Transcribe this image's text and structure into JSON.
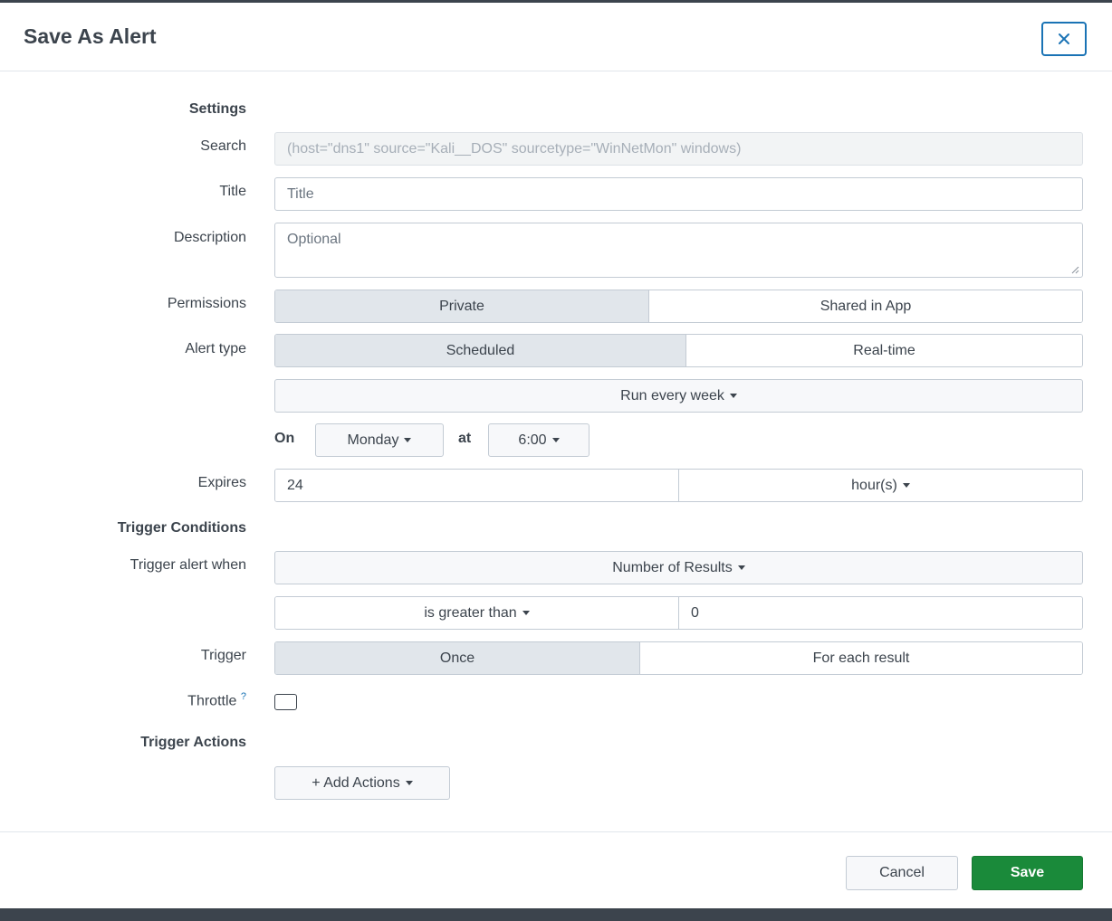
{
  "dialog": {
    "title": "Save As Alert"
  },
  "settings": {
    "heading": "Settings",
    "search": {
      "label": "Search",
      "value": "(host=\"dns1\" source=\"Kali__DOS\" sourcetype=\"WinNetMon\" windows)"
    },
    "title": {
      "label": "Title",
      "placeholder": "Title"
    },
    "description": {
      "label": "Description",
      "placeholder": "Optional"
    },
    "permissions": {
      "label": "Permissions",
      "options": [
        "Private",
        "Shared in App"
      ],
      "selected": "Private"
    },
    "alert_type": {
      "label": "Alert type",
      "options": [
        "Scheduled",
        "Real-time"
      ],
      "selected": "Scheduled"
    },
    "schedule": {
      "value": "Run every week"
    },
    "on": {
      "label": "On",
      "day": "Monday",
      "at_label": "at",
      "time": "6:00"
    },
    "expires": {
      "label": "Expires",
      "value": "24",
      "unit": "hour(s)"
    }
  },
  "trigger_conditions": {
    "heading": "Trigger Conditions",
    "trigger_when": {
      "label": "Trigger alert when",
      "value": "Number of Results"
    },
    "comparison": {
      "operator": "is greater than",
      "value": "0"
    },
    "trigger": {
      "label": "Trigger",
      "options": [
        "Once",
        "For each result"
      ],
      "selected": "Once"
    },
    "throttle": {
      "label": "Throttle",
      "help": "?",
      "checked": false
    }
  },
  "trigger_actions": {
    "heading": "Trigger Actions",
    "add_button": "+ Add Actions"
  },
  "footer": {
    "cancel_label": "Cancel",
    "save_label": "Save"
  },
  "colors": {
    "accent": "#1a73b5",
    "save_green": "#1a8a3a",
    "text": "#3c444d"
  }
}
